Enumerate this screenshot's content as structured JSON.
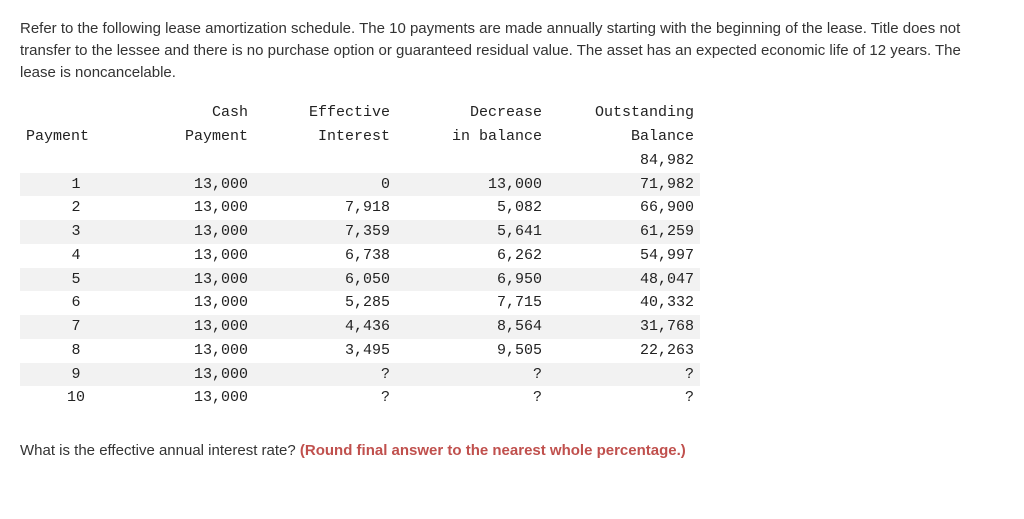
{
  "intro": "Refer to the following lease amortization schedule. The 10 payments are made annually starting with the beginning of the lease. Title does not transfer to the lessee and there is no purchase option or guaranteed residual value. The asset has an expected economic life of 12 years. The lease is noncancelable.",
  "headers": {
    "payment": "Payment",
    "cash_top": "Cash",
    "cash_bot": "Payment",
    "int_top": "Effective",
    "int_bot": "Interest",
    "dec_top": "Decrease",
    "dec_bot": "in balance",
    "bal_top": "Outstanding",
    "bal_bot": "Balance"
  },
  "initial_balance": "84,982",
  "rows": [
    {
      "n": "1",
      "cash": "13,000",
      "int": "0",
      "dec": "13,000",
      "bal": "71,982"
    },
    {
      "n": "2",
      "cash": "13,000",
      "int": "7,918",
      "dec": "5,082",
      "bal": "66,900"
    },
    {
      "n": "3",
      "cash": "13,000",
      "int": "7,359",
      "dec": "5,641",
      "bal": "61,259"
    },
    {
      "n": "4",
      "cash": "13,000",
      "int": "6,738",
      "dec": "6,262",
      "bal": "54,997"
    },
    {
      "n": "5",
      "cash": "13,000",
      "int": "6,050",
      "dec": "6,950",
      "bal": "48,047"
    },
    {
      "n": "6",
      "cash": "13,000",
      "int": "5,285",
      "dec": "7,715",
      "bal": "40,332"
    },
    {
      "n": "7",
      "cash": "13,000",
      "int": "4,436",
      "dec": "8,564",
      "bal": "31,768"
    },
    {
      "n": "8",
      "cash": "13,000",
      "int": "3,495",
      "dec": "9,505",
      "bal": "22,263"
    },
    {
      "n": "9",
      "cash": "13,000",
      "int": "?",
      "dec": "?",
      "bal": "?"
    },
    {
      "n": "10",
      "cash": "13,000",
      "int": "?",
      "dec": "?",
      "bal": "?"
    }
  ],
  "question": "What is the effective annual interest rate?",
  "hint": "(Round final answer to the nearest whole percentage.)",
  "chart_data": {
    "type": "table",
    "title": "Lease Amortization Schedule",
    "columns": [
      "Payment",
      "Cash Payment",
      "Effective Interest",
      "Decrease in balance",
      "Outstanding Balance"
    ],
    "initial_balance": 84982,
    "rows": [
      [
        1,
        13000,
        0,
        13000,
        71982
      ],
      [
        2,
        13000,
        7918,
        5082,
        66900
      ],
      [
        3,
        13000,
        7359,
        5641,
        61259
      ],
      [
        4,
        13000,
        6738,
        6262,
        54997
      ],
      [
        5,
        13000,
        6050,
        6950,
        48047
      ],
      [
        6,
        13000,
        5285,
        7715,
        40332
      ],
      [
        7,
        13000,
        4436,
        8564,
        31768
      ],
      [
        8,
        13000,
        3495,
        9505,
        22263
      ],
      [
        9,
        13000,
        null,
        null,
        null
      ],
      [
        10,
        13000,
        null,
        null,
        null
      ]
    ]
  }
}
